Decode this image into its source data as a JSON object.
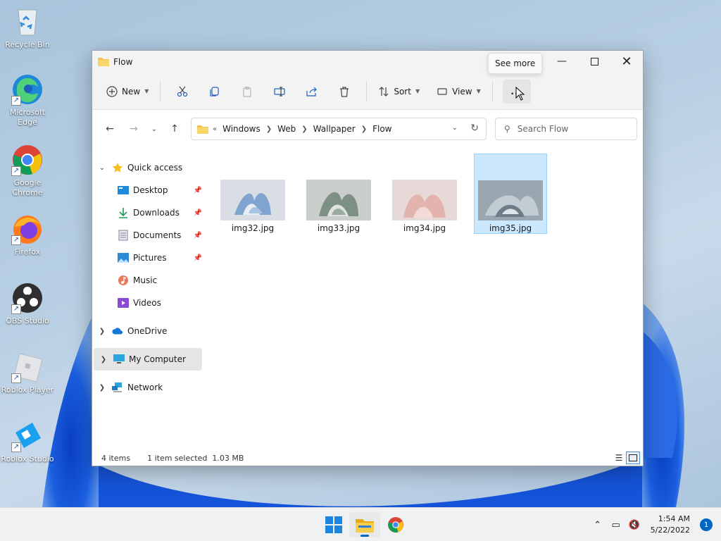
{
  "desktop": {
    "icons": [
      {
        "label": "Recycle Bin"
      },
      {
        "label": "Microsoft Edge"
      },
      {
        "label": "Google Chrome"
      },
      {
        "label": "Firefox"
      },
      {
        "label": "OBS Studio"
      },
      {
        "label": "Roblox Player"
      },
      {
        "label": "Roblox Studio"
      }
    ]
  },
  "window": {
    "title": "Flow",
    "tooltip": "See more",
    "toolbar": {
      "new_label": "New",
      "sort_label": "Sort",
      "view_label": "View",
      "more_label": "..."
    },
    "address": {
      "overflow": "«",
      "crumbs": [
        "Windows",
        "Web",
        "Wallpaper",
        "Flow"
      ]
    },
    "search_placeholder": "Search Flow",
    "nav": {
      "quick_access": "Quick access",
      "items": [
        "Desktop",
        "Downloads",
        "Documents",
        "Pictures",
        "Music",
        "Videos"
      ],
      "onedrive": "OneDrive",
      "my_computer": "My Computer",
      "network": "Network"
    },
    "files": [
      {
        "name": "img32.jpg",
        "selected": false
      },
      {
        "name": "img33.jpg",
        "selected": false
      },
      {
        "name": "img34.jpg",
        "selected": false
      },
      {
        "name": "img35.jpg",
        "selected": true
      }
    ],
    "status": {
      "count": "4 items",
      "selection": "1 item selected  1.03 MB"
    }
  },
  "taskbar": {
    "time": "1:54 AM",
    "date": "5/22/2022",
    "notifications": "1"
  },
  "colors": {
    "accent": "#0067c0",
    "selection": "#cce8ff"
  }
}
